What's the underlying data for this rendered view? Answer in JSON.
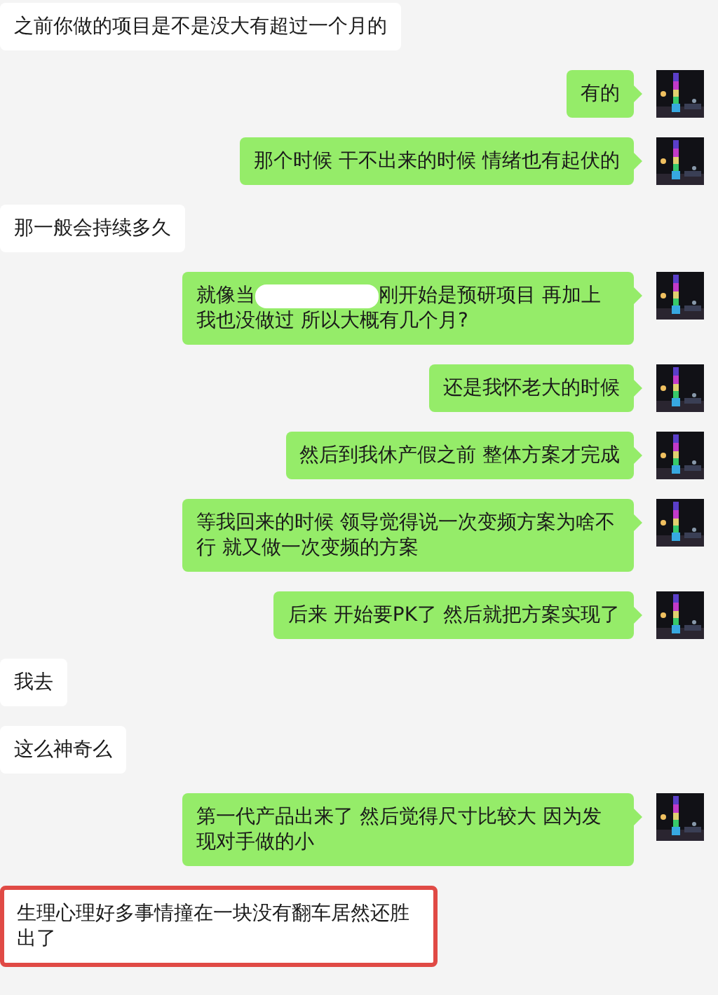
{
  "messages": [
    {
      "outgoing": false,
      "kind": "text",
      "text": "之前你做的项目是不是没大有超过一个月的",
      "highlighted": false
    },
    {
      "outgoing": true,
      "kind": "text",
      "text": "有的",
      "highlighted": false
    },
    {
      "outgoing": true,
      "kind": "text",
      "text": "那个时候 干不出来的时候 情绪也有起伏的",
      "highlighted": false
    },
    {
      "outgoing": false,
      "kind": "text",
      "text": "那一般会持续多久",
      "highlighted": false
    },
    {
      "outgoing": true,
      "kind": "redacted",
      "text_before": "就像当",
      "text_after": "刚开始是预研项目 再加上我也没做过 所以大概有几个月?",
      "highlighted": false
    },
    {
      "outgoing": true,
      "kind": "text",
      "text": "还是我怀老大的时候",
      "highlighted": false
    },
    {
      "outgoing": true,
      "kind": "text",
      "text": "然后到我休产假之前 整体方案才完成",
      "highlighted": false
    },
    {
      "outgoing": true,
      "kind": "text",
      "text": "等我回来的时候 领导觉得说一次变频方案为啥不行 就又做一次变频的方案",
      "highlighted": false
    },
    {
      "outgoing": true,
      "kind": "text",
      "text": "后来 开始要PK了 然后就把方案实现了",
      "highlighted": false
    },
    {
      "outgoing": false,
      "kind": "text",
      "text": "我去",
      "highlighted": false
    },
    {
      "outgoing": false,
      "kind": "text",
      "text": "这么神奇么",
      "highlighted": false
    },
    {
      "outgoing": true,
      "kind": "text",
      "text": "第一代产品出来了 然后觉得尺寸比较大 因为发现对手做的小",
      "highlighted": false
    },
    {
      "outgoing": false,
      "kind": "text",
      "text": "生理心理好多事情撞在一块没有翻车居然还胜出了",
      "highlighted": true
    }
  ]
}
